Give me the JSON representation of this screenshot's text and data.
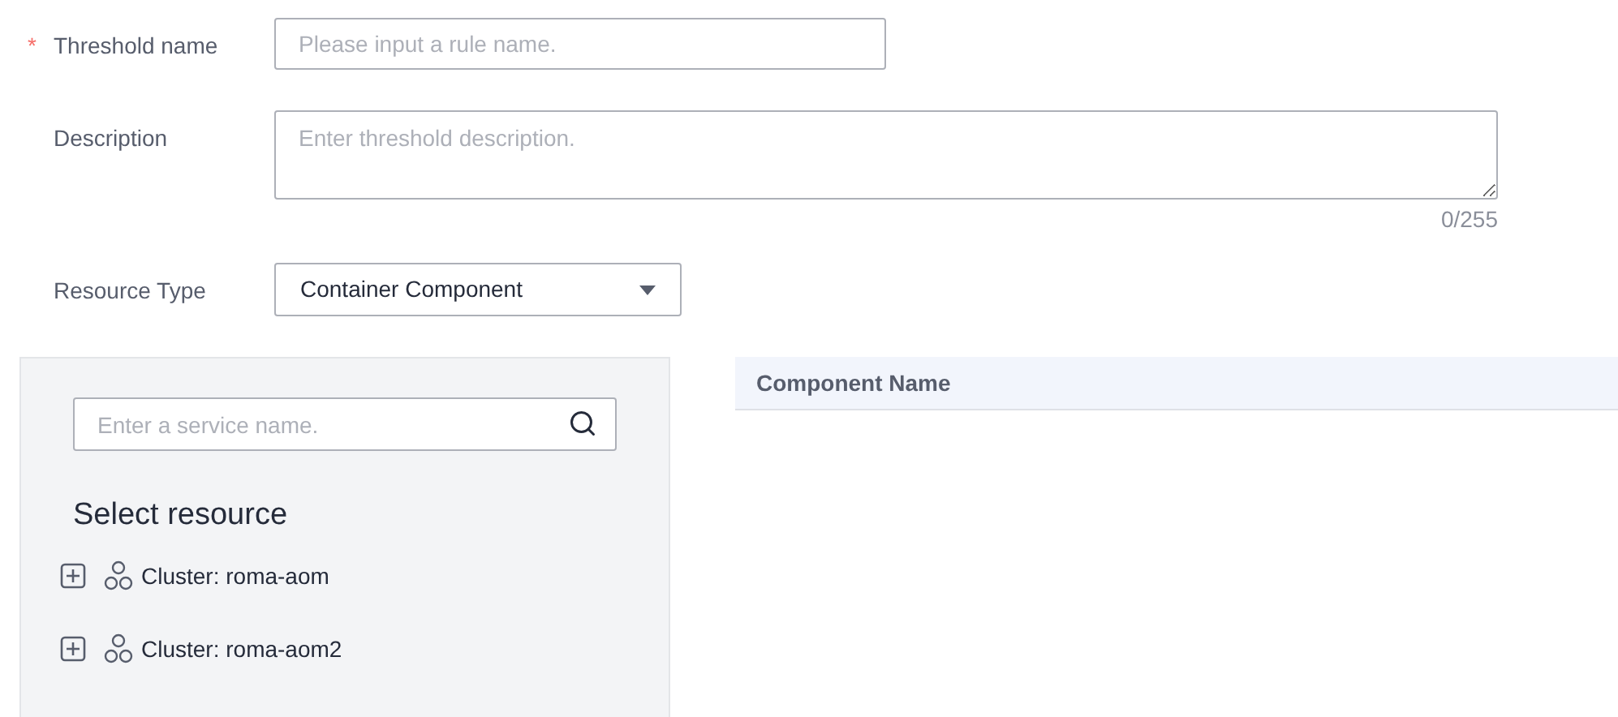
{
  "form": {
    "fields": [
      {
        "kind": "input",
        "label": "Threshold name",
        "required_mark": "*",
        "placeholder": "Please input a rule name."
      },
      {
        "kind": "textarea",
        "label": "Description",
        "placeholder": "Enter threshold description.",
        "counter": "0/255"
      },
      {
        "kind": "select",
        "label": "Resource Type",
        "value": "Container Component"
      }
    ]
  },
  "resource_panel": {
    "search": {
      "placeholder": "Enter a service name."
    },
    "title": "Select resource",
    "tree": [
      {
        "label": "Cluster: roma-aom",
        "expanded": false
      },
      {
        "label": "Cluster: roma-aom2",
        "expanded": false
      }
    ]
  },
  "table": {
    "columns": [
      "Component Name"
    ]
  }
}
